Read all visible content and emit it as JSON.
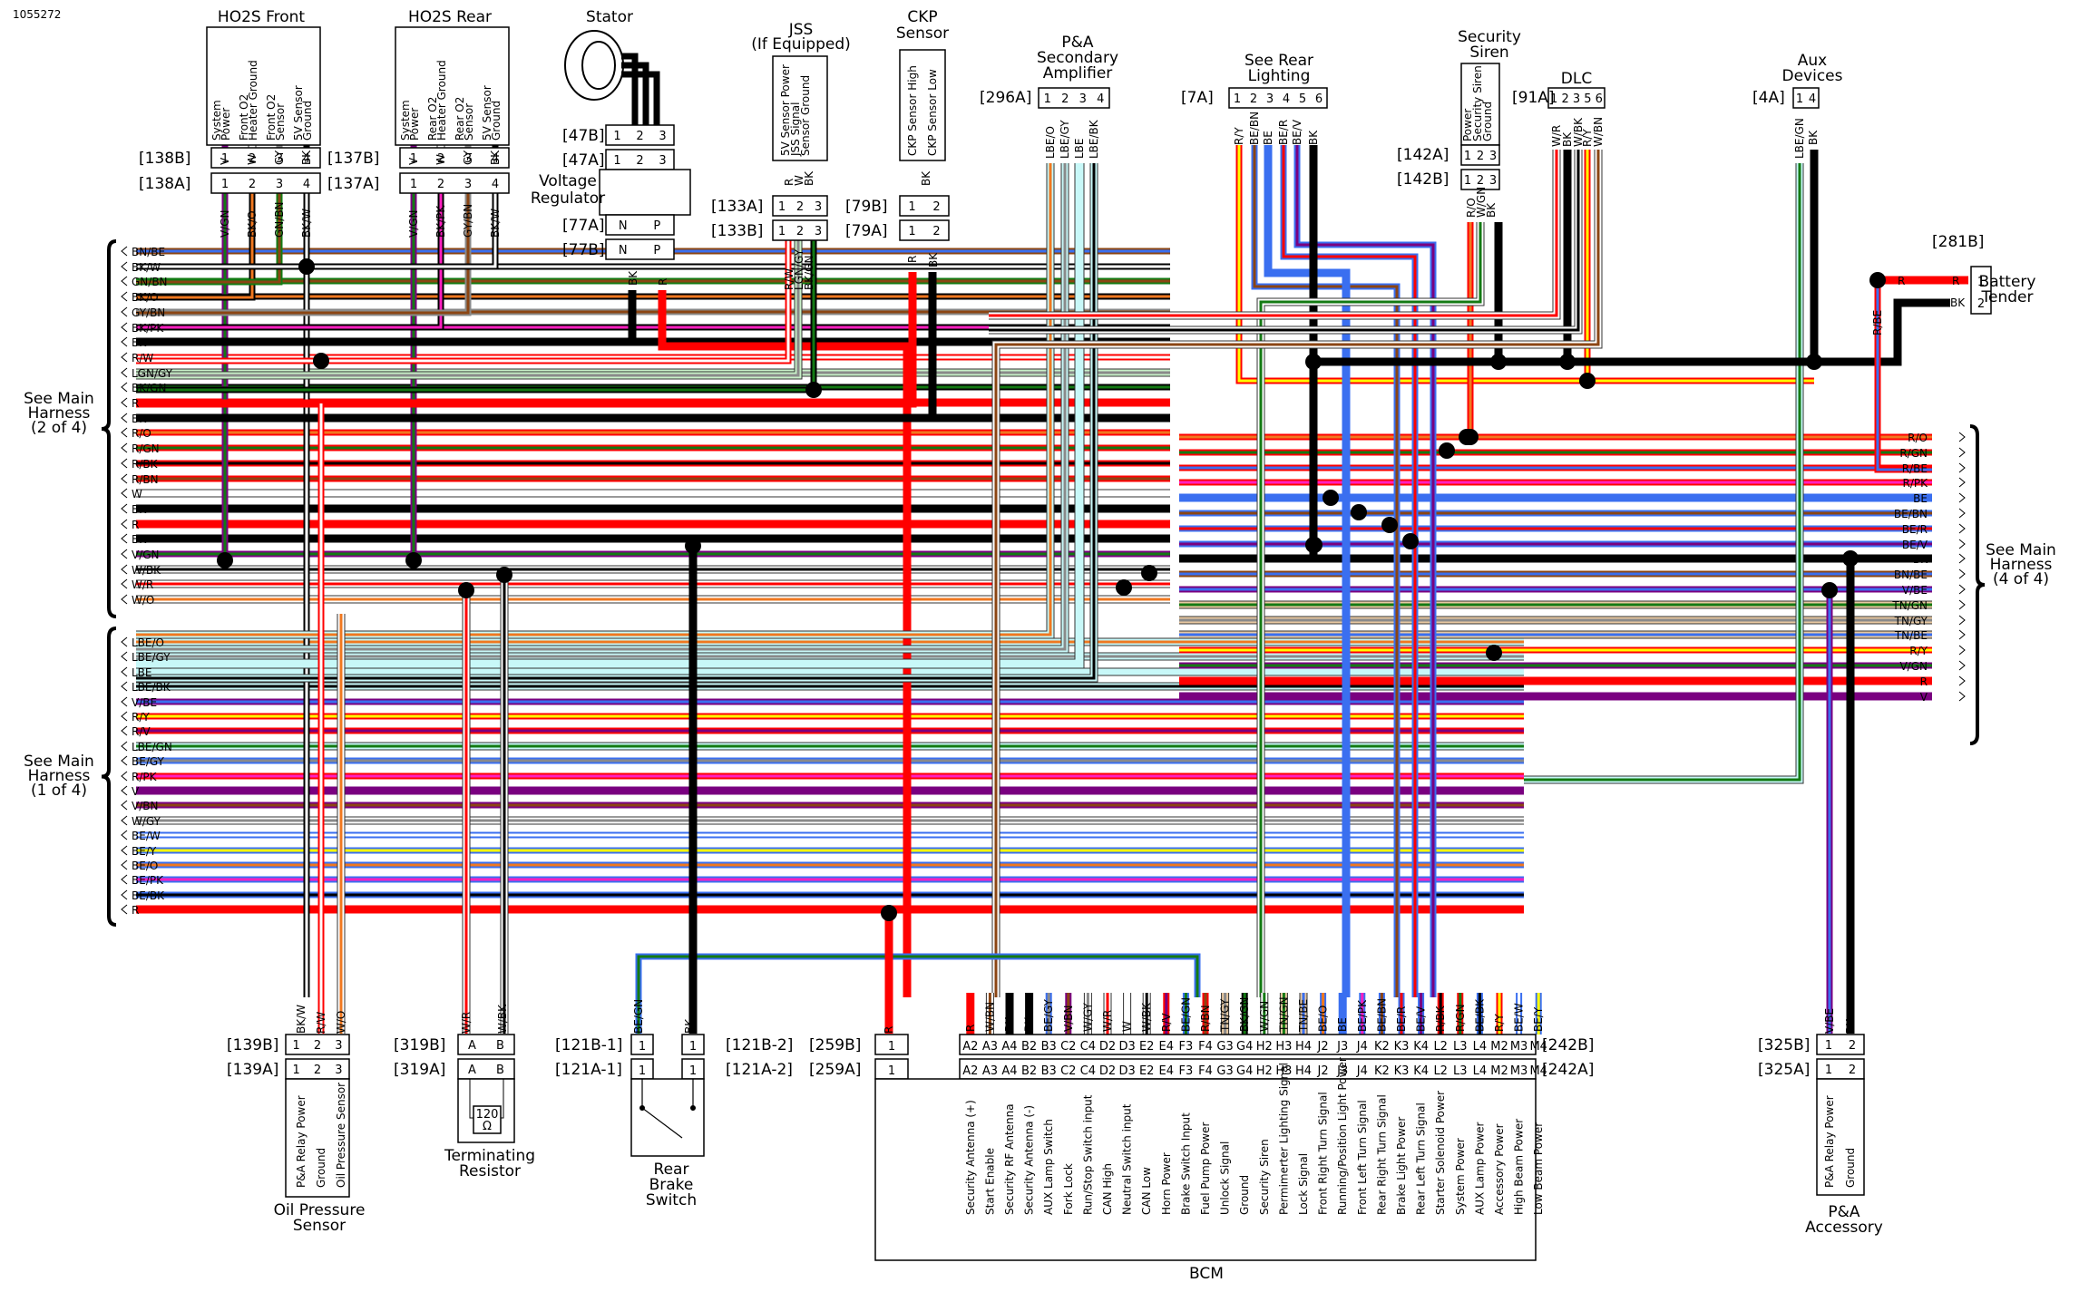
{
  "document_id": "1055272",
  "harness_groups": {
    "left_top": {
      "label": [
        "See Main",
        "Harness",
        "(2 of 4)"
      ],
      "wires": [
        "BN/BE",
        "BK/W",
        "GN/BN",
        "BK/O",
        "GY/BN",
        "BK/PK",
        "BK",
        "R/W",
        "LGN/GY",
        "BK/GN",
        "R",
        "BK",
        "R/O",
        "R/GN",
        "R/BK",
        "R/BN",
        "W",
        "BK",
        "R",
        "BK",
        "V/GN",
        "W/BK",
        "W/R",
        "W/O"
      ]
    },
    "left_bottom": {
      "label": [
        "See Main",
        "Harness",
        "(1 of 4)"
      ],
      "wires": [
        "LBE/O",
        "LBE/GY",
        "LBE",
        "LBE/BK",
        "V/BE",
        "R/Y",
        "R/V",
        "LBE/GN",
        "BE/GY",
        "R/PK",
        "V",
        "V/BN",
        "W/GY",
        "BE/W",
        "BE/Y",
        "BE/O",
        "BE/PK",
        "BE/BK",
        "R"
      ]
    },
    "right": {
      "label": [
        "See Main",
        "Harness",
        "(4 of 4)"
      ],
      "wires": [
        "R/O",
        "R/GN",
        "R/BE",
        "R/PK",
        "BE",
        "BE/BN",
        "BE/R",
        "BE/V",
        "BK",
        "BN/BE",
        "V/BE",
        "TN/GN",
        "TN/GY",
        "TN/BE",
        "R/Y",
        "V/GN",
        "R",
        "V"
      ]
    }
  },
  "components_top": [
    {
      "name": "HO2S Front",
      "functions": [
        "System Power",
        "Front O2 Heater Ground",
        "Front O2 Sensor",
        "5V Sensor Ground"
      ],
      "wires_upper": [
        "V",
        "W",
        "GY",
        "BK"
      ],
      "connector_b": "[138B]",
      "connector_a": "[138A]",
      "pins": [
        "1",
        "2",
        "3",
        "4"
      ],
      "wires_lower": [
        "V/GN",
        "BK/O",
        "GN/BN",
        "BK/W"
      ]
    },
    {
      "name": "HO2S Rear",
      "functions": [
        "System Power",
        "Rear O2 Heater Ground",
        "Rear O2 Sensor",
        "5V Sensor Ground"
      ],
      "wires_upper": [
        "V",
        "W",
        "GY",
        "BK"
      ],
      "connector_b": "[137B]",
      "connector_a": "[137A]",
      "pins": [
        "1",
        "2",
        "3",
        "4"
      ],
      "wires_lower": [
        "V/GN",
        "BK/PK",
        "GY/BN",
        "BK/W"
      ]
    },
    {
      "name": "Stator",
      "connector_b": "[47B]",
      "connector_a": "[47A]",
      "pins": [
        "1",
        "2",
        "3"
      ],
      "sub_component": "Voltage Regulator",
      "regulator_connector_a": "[77A]",
      "regulator_connector_b": "[77B]",
      "regulator_pins": [
        "N",
        "P"
      ],
      "wires_lower": [
        "BK",
        "R"
      ]
    },
    {
      "name": "JSS (If Equipped)",
      "functions": [
        "5V Sensor Power",
        "JSS Signal",
        "Sensor Ground"
      ],
      "wires_upper": [
        "R",
        "W",
        "BK"
      ],
      "connector_a": "[133A]",
      "connector_b": "[133B]",
      "pins": [
        "1",
        "2",
        "3"
      ],
      "wires_lower": [
        "R/W",
        "LGN/GY",
        "BK/GN"
      ]
    },
    {
      "name": "CKP Sensor",
      "functions": [
        "CKP Sensor High",
        "CKP Sensor Low"
      ],
      "wires_upper": [
        "BK"
      ],
      "connector_b": "[79B]",
      "connector_a": "[79A]",
      "pins": [
        "1",
        "2"
      ],
      "wires_lower": [
        "R",
        "BK"
      ]
    },
    {
      "name": "P&A Secondary Amplifier",
      "connector_a": "[296A]",
      "pins": [
        "1",
        "2",
        "3",
        "4"
      ],
      "wires_lower": [
        "LBE/O",
        "LBE/GY",
        "LBE",
        "LBE/BK"
      ]
    },
    {
      "name": "See Rear Lighting",
      "connector_a": "[7A]",
      "pins": [
        "1",
        "2",
        "3",
        "4",
        "5",
        "6"
      ],
      "wires_lower": [
        "R/Y",
        "BE/BN",
        "BE",
        "BE/R",
        "BE/V",
        "BK"
      ]
    },
    {
      "name": "Security Siren",
      "functions": [
        "Power",
        "Security Siren",
        "Ground"
      ],
      "connector_a": "[142A]",
      "connector_b": "[142B]",
      "pins": [
        "1",
        "2",
        "3"
      ],
      "wires_lower": [
        "R/O",
        "W/GN",
        "BK"
      ]
    },
    {
      "name": "DLC",
      "connector_a": "[91A]",
      "pins": [
        "1",
        "2",
        "3",
        "5",
        "6"
      ],
      "wires_lower": [
        "W/R",
        "BK",
        "W/BK",
        "R/Y",
        "W/BN"
      ]
    },
    {
      "name": "Aux Devices",
      "connector_a": "[4A]",
      "pins": [
        "1",
        "4"
      ],
      "wires_lower": [
        "LBE/GN",
        "BK"
      ]
    },
    {
      "name": "Battery Tender",
      "connector_b": "[281B]",
      "pins": [
        "1",
        "2"
      ],
      "wires": [
        "R",
        "BK"
      ],
      "feed_wire": "R/BE"
    }
  ],
  "components_bottom": [
    {
      "name": "Oil Pressure Sensor",
      "connector_b": "[139B]",
      "connector_a": "[139A]",
      "pins": [
        "1",
        "2",
        "3"
      ],
      "wires": [
        "BK/W",
        "R/W",
        "W/O"
      ],
      "functions": [
        "P&A Relay Power",
        "Ground",
        "Oil Pressure Sensor"
      ]
    },
    {
      "name": "Terminating Resistor",
      "connector_b": "[319B]",
      "connector_a": "[319A]",
      "pins": [
        "A",
        "B"
      ],
      "wires": [
        "W/R",
        "W/BK"
      ],
      "resistor_value": "120",
      "resistor_unit": "Ω"
    },
    {
      "name": "Rear Brake Switch",
      "connector_b1": "[121B-1]",
      "connector_a1": "[121A-1]",
      "connector_b2": "[121B-2]",
      "connector_a2": "[121A-2]",
      "pins": [
        "1",
        "1"
      ],
      "wires": [
        "BE/GN",
        "BK"
      ]
    },
    {
      "name": "BCM",
      "connector_b_left": "[259B]",
      "connector_a_left": "[259A]",
      "left_pin": "1",
      "left_wire": "R",
      "connector_b": "[242B]",
      "connector_a": "[242A]",
      "pins": [
        "A2",
        "A3",
        "A4",
        "B2",
        "B3",
        "C2",
        "C4",
        "D2",
        "D3",
        "E2",
        "E4",
        "F3",
        "F4",
        "G3",
        "G4",
        "H2",
        "H3",
        "H4",
        "J2",
        "J3",
        "J4",
        "K2",
        "K3",
        "K4",
        "L2",
        "L3",
        "L4",
        "M2",
        "M3",
        "M4"
      ],
      "wires": [
        "R",
        "W/BN",
        "BK",
        "BK",
        "BE/GY",
        "V/BN",
        "W/GY",
        "W/R",
        "W",
        "W/BK",
        "R/V",
        "BE/GN",
        "R/BN",
        "TN/GY",
        "BK/GN",
        "W/GN",
        "TN/GN",
        "TN/BE",
        "BE/O",
        "BE",
        "BE/PK",
        "BE/BN",
        "BE/R",
        "BE/V",
        "R/BK",
        "R/GN",
        "BE/BK",
        "R/Y",
        "BE/W",
        "BE/Y"
      ],
      "functions": [
        "Security Antenna (+)",
        "Start Enable",
        "Security RF Antenna",
        "Security Antenna (-)",
        "AUX Lamp Switch",
        "Fork Lock",
        "Run/Stop Switch input",
        "CAN High",
        "Neutral Switch input",
        "CAN Low",
        "Horn Power",
        "Brake Switch Input",
        "Fuel Pump Power",
        "Unlock Signal",
        "Ground",
        "Security Siren",
        "Permimerter Lighting Signal",
        "Lock Signal",
        "Front Right Turn Signal",
        "Running/Position Light Power",
        "Front Left Turn Signal",
        "Rear Right Turn Signal",
        "Brake Light Power",
        "Rear Left Turn Signal",
        "Starter Solenoid Power",
        "System Power",
        "AUX Lamp Power",
        "Accessory Power",
        "High Beam Power",
        "Low Beam Power"
      ]
    },
    {
      "name": "P&A Accessory",
      "connector_b": "[325B]",
      "connector_a": "[325A]",
      "pins": [
        "1",
        "2"
      ],
      "wires": [
        "V/BE",
        "BK"
      ],
      "functions": [
        "P&A Relay Power",
        "Ground"
      ]
    }
  ],
  "wire_colors": {
    "BK": "#000000",
    "W": "#ffffff",
    "R": "#ff0000",
    "O": "#f07820",
    "GN": "#137a13",
    "LGN": "#c8f0c8",
    "GY": "#8a8a8a",
    "BN": "#8b4513",
    "BE": "#3a6ff0",
    "LBE": "#c8f8f8",
    "V": "#7a0080",
    "PK": "#ff1fc0",
    "Y": "#ffff00",
    "TN": "#e8c8a0"
  }
}
